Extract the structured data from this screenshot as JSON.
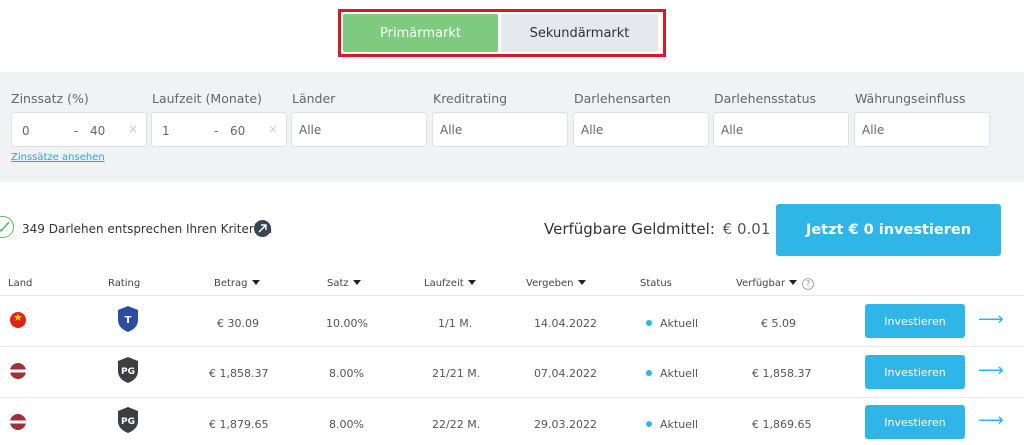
{
  "tabs": {
    "primary": "Primärmarkt",
    "secondary": "Sekundärmarkt"
  },
  "filters": {
    "interest": {
      "label": "Zinssatz (%)",
      "min": "0",
      "max": "40"
    },
    "term": {
      "label": "Laufzeit (Monate)",
      "min": "1",
      "max": "60"
    },
    "countries": {
      "label": "Länder",
      "value": "Alle"
    },
    "rating": {
      "label": "Kreditrating",
      "value": "Alle"
    },
    "loan_types": {
      "label": "Darlehensarten",
      "value": "Alle"
    },
    "loan_status": {
      "label": "Darlehensstatus",
      "value": "Alle"
    },
    "currency": {
      "label": "Währungseinfluss",
      "value": "Alle"
    },
    "dash": "-",
    "clear": "×",
    "rates_link": "Zinssätze ansehen"
  },
  "summary": {
    "match_text": "349 Darlehen entsprechen Ihren Kriterien",
    "funds_label": "Verfügbare Geldmittel:",
    "funds_value": "€ 0.01",
    "invest_all": "Jetzt € 0 investieren"
  },
  "table": {
    "headers": {
      "land": "Land",
      "rating": "Rating",
      "betrag": "Betrag",
      "satz": "Satz",
      "laufzeit": "Laufzeit",
      "vergeben": "Vergeben",
      "status": "Status",
      "verfuegbar": "Verfügbar"
    },
    "rows": [
      {
        "country": "vn",
        "rating": "T",
        "rating_color": "#2d4ea0",
        "amount": "€ 30.09",
        "rate": "10.00%",
        "term": "1/1 M.",
        "issued": "14.04.2022",
        "status": "Aktuell",
        "available": "€ 5.09",
        "action": "Investieren"
      },
      {
        "country": "lv",
        "rating": "PG",
        "rating_color": "#3a3f44",
        "amount": "€ 1,858.37",
        "rate": "8.00%",
        "term": "21/21 M.",
        "issued": "07.04.2022",
        "status": "Aktuell",
        "available": "€ 1,858.37",
        "action": "Investieren"
      },
      {
        "country": "lv",
        "rating": "PG",
        "rating_color": "#3a3f44",
        "amount": "€ 1,879.65",
        "rate": "8.00%",
        "term": "22/22 M.",
        "issued": "29.03.2022",
        "status": "Aktuell",
        "available": "€ 1,869.65",
        "action": "Investieren"
      }
    ]
  },
  "colors": {
    "accent": "#2fb5e8",
    "primary_tab": "#7ecb80",
    "highlight_border": "#d11a2a"
  }
}
